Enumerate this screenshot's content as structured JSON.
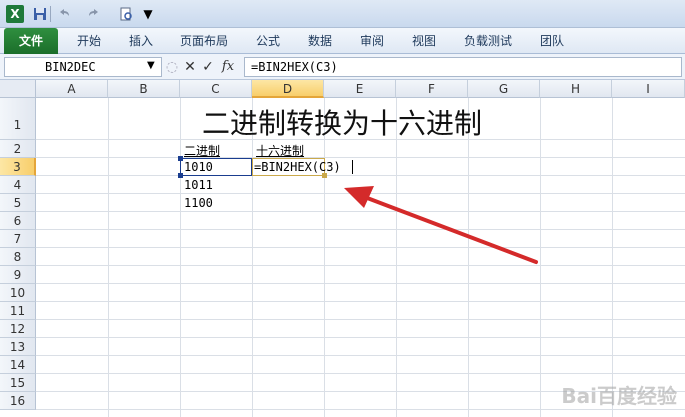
{
  "app": {
    "icon_letter": "X"
  },
  "quick_access": {
    "icons": [
      "excel-icon",
      "save-icon",
      "undo-icon",
      "redo-icon",
      "print-preview-icon",
      "customize-qat-icon"
    ]
  },
  "ribbon": {
    "tabs": [
      {
        "label": "文件",
        "key": "file"
      },
      {
        "label": "开始",
        "key": "home"
      },
      {
        "label": "插入",
        "key": "insert"
      },
      {
        "label": "页面布局",
        "key": "page-layout"
      },
      {
        "label": "公式",
        "key": "formulas"
      },
      {
        "label": "数据",
        "key": "data"
      },
      {
        "label": "审阅",
        "key": "review"
      },
      {
        "label": "视图",
        "key": "view"
      },
      {
        "label": "负载测试",
        "key": "load-test"
      },
      {
        "label": "团队",
        "key": "team"
      }
    ]
  },
  "formula_bar": {
    "name_box": "BIN2DEC",
    "cancel_symbol": "✕",
    "enter_symbol": "✓",
    "fx_label": "fx",
    "formula": "=BIN2HEX(C3)"
  },
  "sheet": {
    "columns": [
      "A",
      "B",
      "C",
      "D",
      "E",
      "F",
      "G",
      "H",
      "I"
    ],
    "active_column": "D",
    "rows": [
      "1",
      "2",
      "3",
      "4",
      "5",
      "6",
      "7",
      "8",
      "9",
      "10",
      "11",
      "12",
      "13",
      "14",
      "15",
      "16"
    ],
    "active_row": "3",
    "title": "二进制转换为十六进制",
    "header_c2": "二进制",
    "header_d2": "十六进制",
    "c3": "1010",
    "c4": "1011",
    "c5": "1100",
    "d3_editing": "=BIN2HEX(C3)"
  },
  "colors": {
    "arrow": "#d42a2a",
    "accent": "#1f7a3a"
  },
  "watermark": "Bai百度经验"
}
